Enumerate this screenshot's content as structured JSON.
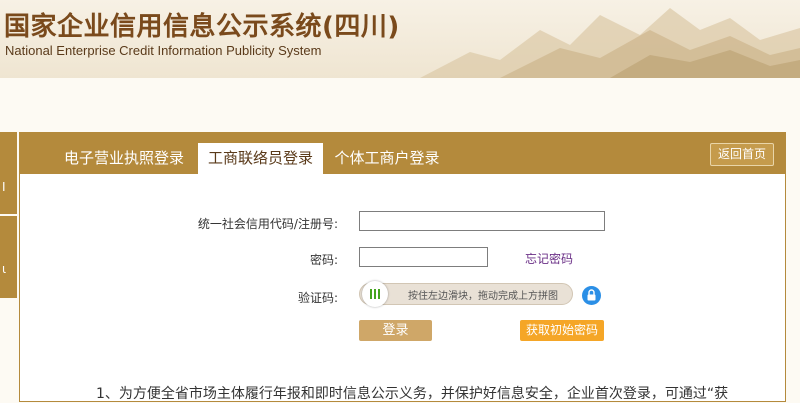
{
  "header": {
    "title_cn": "国家企业信用信息公示系统(四川)",
    "title_en": "National Enterprise Credit Information Publicity System"
  },
  "side": {
    "glyph1": "Ⅰ",
    "glyph2": "ι"
  },
  "tabs": [
    {
      "label": "电子营业执照登录",
      "active": false
    },
    {
      "label": "工商联络员登录",
      "active": true
    },
    {
      "label": "个体工商户登录",
      "active": false
    }
  ],
  "back_home": "返回首页",
  "form": {
    "code_label": "统一社会信用代码/注册号:",
    "code_value": "",
    "password_label": "密码:",
    "password_value": "",
    "forgot_link": "忘记密码",
    "captcha_label": "验证码:",
    "slider_hint": "按住左边滑块，拖动完成上方拼图",
    "login_button": "登录",
    "get_initial_password_button": "获取初始密码"
  },
  "note": "1、为方便全省市场主体履行年报和即时信息公示义务，并保护好信息安全，企业首次登录，可通过“获",
  "colors": {
    "accent": "#b48a3c",
    "login_btn": "#cfa768",
    "init_btn": "#f5a627",
    "forgot_link": "#6a2e86"
  },
  "icons": {
    "lock": "lock-icon",
    "slider_handle": "slider-handle-icon"
  }
}
